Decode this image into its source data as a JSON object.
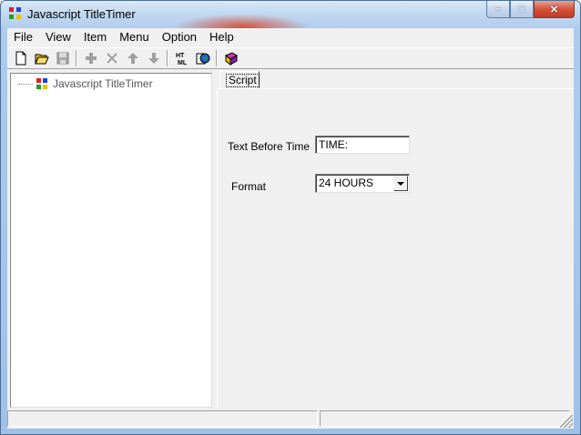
{
  "window": {
    "title": "Javascript TitleTimer",
    "buttons": {
      "minimize": "–",
      "maximize": "□",
      "close": "✕"
    }
  },
  "menu": [
    "File",
    "View",
    "Item",
    "Menu",
    "Option",
    "Help"
  ],
  "toolbar": [
    {
      "icon": "new-document-icon",
      "enabled": true
    },
    {
      "icon": "open-folder-icon",
      "enabled": true
    },
    {
      "icon": "save-icon",
      "enabled": false
    },
    {
      "icon": "add-icon",
      "enabled": false
    },
    {
      "icon": "delete-icon",
      "enabled": false
    },
    {
      "icon": "move-up-icon",
      "enabled": false
    },
    {
      "icon": "move-down-icon",
      "enabled": false
    },
    {
      "icon": "html-icon",
      "label": "HTML",
      "enabled": true
    },
    {
      "icon": "preview-globe-icon",
      "enabled": true
    },
    {
      "icon": "help-book-icon",
      "enabled": true
    }
  ],
  "tree": {
    "items": [
      {
        "label": "Javascript TitleTimer"
      }
    ]
  },
  "tabs": [
    {
      "label": "Script",
      "active": true
    }
  ],
  "form": {
    "text_before_time": {
      "label": "Text Before Time",
      "value": "TIME:"
    },
    "format": {
      "label": "Format",
      "value": "24 HOURS"
    }
  },
  "statusbar": {
    "panes": [
      "",
      ""
    ]
  },
  "colors": {
    "icon_red": "#e02020",
    "icon_blue": "#2040e0",
    "icon_green": "#20a020",
    "icon_yellow": "#e8c000"
  }
}
